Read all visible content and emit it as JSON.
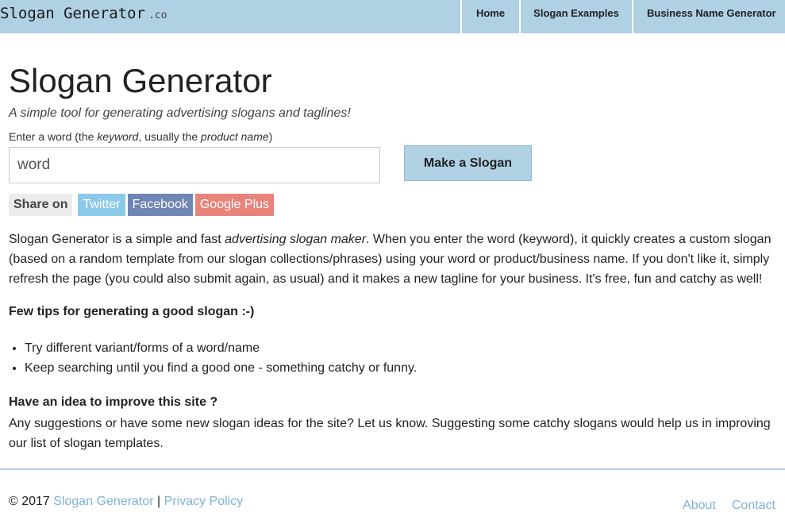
{
  "header": {
    "brand": "Slogan Generator",
    "brand_tld": ".co",
    "nav": [
      "Home",
      "Slogan Examples",
      "Business Name Generator"
    ]
  },
  "main": {
    "title": "Slogan Generator",
    "subtitle": "A simple tool for generating advertising slogans and taglines!",
    "field_label": {
      "before": "Enter a word (the ",
      "keyword": "keyword",
      "middle": ", usually the ",
      "product": "product name",
      "after": ")"
    },
    "input_placeholder": "word",
    "button_label": "Make a Slogan",
    "share": {
      "label": "Share on",
      "buttons": [
        "Twitter",
        "Facebook",
        "Google Plus"
      ]
    },
    "intro": {
      "before": "Slogan Generator is a simple and fast ",
      "emphasis": "advertising slogan maker",
      "after": ". When you enter the word (keyword), it quickly creates a custom slogan (based on a random template from our slogan collections/phrases) using your word or product/business name. If you don't like it, simply refresh the page (you could also submit again, as usual) and it makes a new tagline for your business. It's free, fun and catchy as well!"
    },
    "tips_title": "Few tips for generating a good slogan :-)",
    "tips": [
      "Try different variant/forms of a word/name",
      "Keep searching until you find a good one - something catchy or funny."
    ],
    "idea_title": "Have an idea to improve this site ?",
    "idea_text": "Any suggestions or have some new slogan ideas for the site? Let us know. Suggesting some catchy slogans would help us in improving our list of slogan templates."
  },
  "footer": {
    "copyright": "© 2017 ",
    "site_link": "Slogan Generator",
    "separator": " | ",
    "privacy_link": "Privacy Policy",
    "about_link": "About",
    "contact_link": "Contact"
  },
  "colors": {
    "header_bg": "#b0d0e4",
    "link": "#7fb2d6",
    "twitter": "#8cc8ea",
    "facebook": "#6f85b3",
    "google_plus": "#e7837a"
  }
}
